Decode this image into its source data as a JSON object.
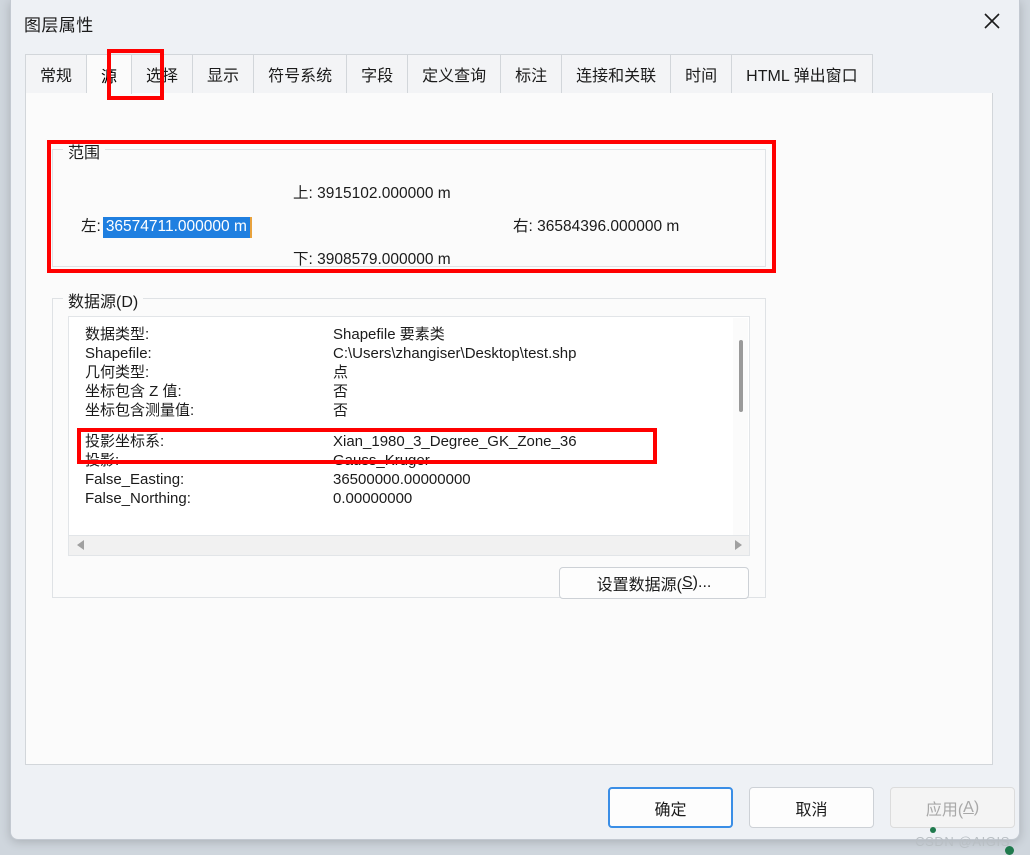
{
  "window": {
    "title": "图层属性",
    "close_icon": "close-icon"
  },
  "tabs": [
    {
      "label": "常规",
      "active": false
    },
    {
      "label": "源",
      "active": true
    },
    {
      "label": "选择",
      "active": false
    },
    {
      "label": "显示",
      "active": false
    },
    {
      "label": "符号系统",
      "active": false
    },
    {
      "label": "字段",
      "active": false
    },
    {
      "label": "定义查询",
      "active": false
    },
    {
      "label": "标注",
      "active": false
    },
    {
      "label": "连接和关联",
      "active": false
    },
    {
      "label": "时间",
      "active": false
    },
    {
      "label": "HTML 弹出窗口",
      "active": false
    }
  ],
  "extent": {
    "legend": "范围",
    "top_label": "上:",
    "top_value": "3915102.000000 m",
    "left_label": "左:",
    "left_value": "36574711.000000 m",
    "right_label": "右:",
    "right_value": "36584396.000000 m",
    "bottom_label": "下:",
    "bottom_value": "3908579.000000 m"
  },
  "datasource": {
    "legend": "数据源(D)",
    "rows": [
      {
        "key": "数据类型:",
        "value": "Shapefile 要素类"
      },
      {
        "key": "Shapefile:",
        "value": "C:\\Users\\zhangiser\\Desktop\\test.shp"
      },
      {
        "key": "几何类型:",
        "value": "点"
      },
      {
        "key": "坐标包含 Z 值:",
        "value": "否"
      },
      {
        "key": "坐标包含测量值:",
        "value": "否"
      },
      {
        "key": "",
        "value": ""
      },
      {
        "key": "投影坐标系:",
        "value": "Xian_1980_3_Degree_GK_Zone_36"
      },
      {
        "key": "投影:",
        "value": "Gauss_Kruger"
      },
      {
        "key": "False_Easting:",
        "value": "36500000.00000000"
      },
      {
        "key": "False_Northing:",
        "value": "0.00000000"
      }
    ],
    "set_source_button": {
      "text_before": "设置数据源(",
      "mnemonic": "S",
      "text_after": ")..."
    },
    "scroll_left_icon": "triangle-left-icon",
    "scroll_right_icon": "triangle-right-icon"
  },
  "footer": {
    "ok": "确定",
    "cancel": "取消",
    "apply_before": "应用(",
    "apply_mnemonic": "A",
    "apply_after": ")"
  },
  "watermark": "CSDN @AIGIS",
  "colors": {
    "annotation": "#ff0000",
    "selection": "#1f7fe0",
    "focus": "#3a8ee6",
    "titlebar": "#eef1f5",
    "content": "#fbfbfb"
  }
}
